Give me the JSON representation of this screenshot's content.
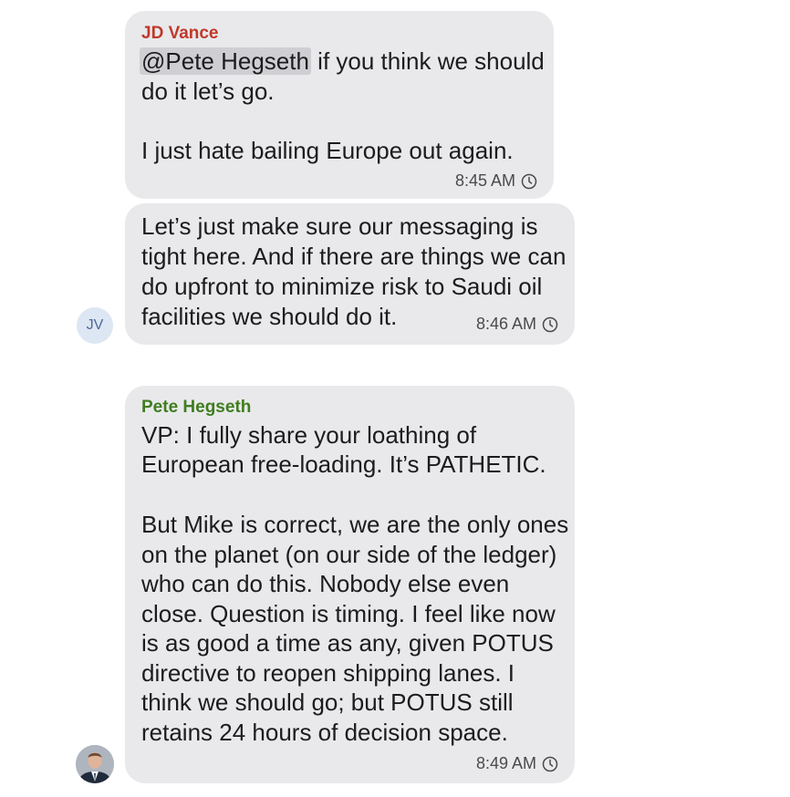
{
  "messages": [
    {
      "sender": "JD Vance",
      "sender_color": "#c0392b",
      "mention": "@Pete Hegseth",
      "lines": [
        " if you think we should",
        "do it let’s go.",
        "I just hate bailing Europe out again."
      ],
      "time": "8:45 AM"
    },
    {
      "lines": [
        "Let’s just make sure our messaging is",
        "tight here. And if there are things we can",
        "do upfront to minimize risk to Saudi oil",
        "facilities we should do it."
      ],
      "time": "8:46 AM",
      "avatar_initials": "JV"
    },
    {
      "sender": "Pete Hegseth",
      "sender_color": "#3f7d20",
      "lines": [
        "VP: I fully share your loathing of",
        "European free-loading. It’s PATHETIC.",
        "But Mike is correct, we are the only ones",
        "on the planet (on our side of the ledger)",
        "who can do this. Nobody else even",
        "close. Question is timing. I feel like now",
        "is as good a time as any, given POTUS",
        "directive to reopen shipping lanes. I",
        "think we should go; but POTUS still",
        "retains 24 hours of decision space."
      ],
      "time": "8:49 AM"
    }
  ],
  "icons": {
    "status": "clock-icon",
    "avatar": "profile-photo"
  },
  "colors": {
    "bubble": "#e9e9eb",
    "text": "#1c1c1e"
  }
}
